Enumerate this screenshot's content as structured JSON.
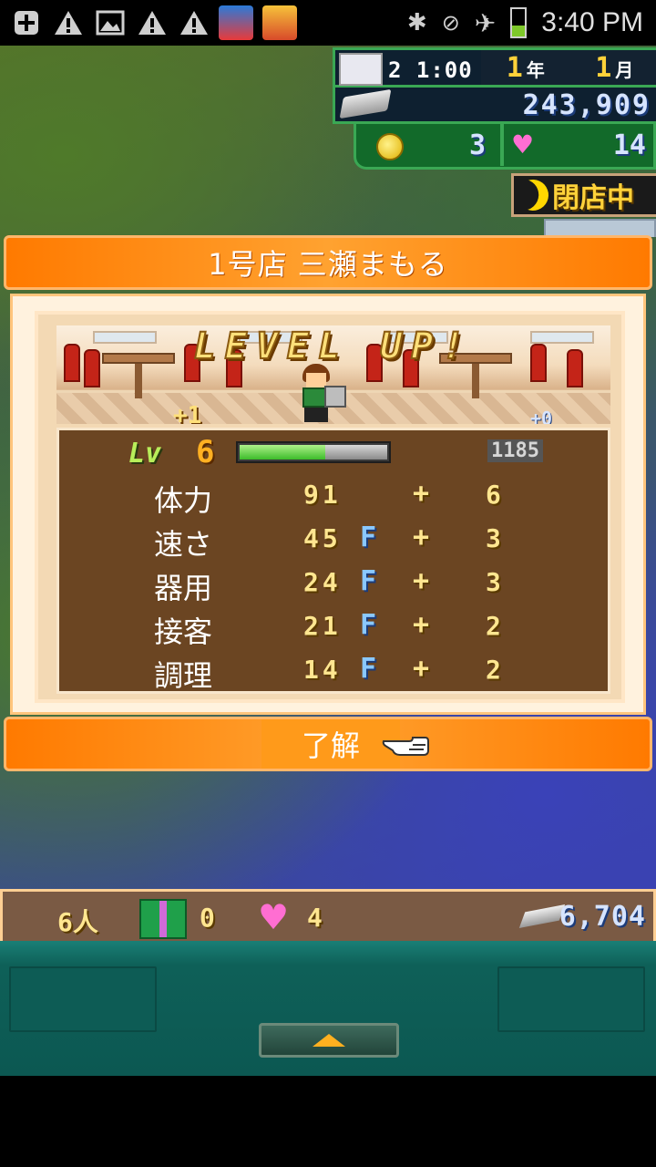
{
  "status_bar": {
    "time": "3:40 PM",
    "icons": [
      "plus-icon",
      "warning-icon",
      "gallery-icon",
      "warning-icon",
      "warning-icon",
      "bingo-app-icon",
      "shinchan-app-icon"
    ],
    "right_icons": [
      "bluetooth-icon",
      "no-signal-icon",
      "airplane-icon",
      "battery-icon"
    ]
  },
  "hud": {
    "clock": "2 1:00",
    "year_num": "1",
    "year_unit": "年",
    "month_num": "1",
    "month_unit": "月",
    "money": "243,909",
    "coins": "3",
    "hearts": "14",
    "open_label": "閉店中"
  },
  "dialog": {
    "title": "1号店 三瀬まもる",
    "banner": "LEVEL UP!",
    "plus_left": "+1",
    "plus_right": "+0",
    "level_label": "Lv",
    "level": "6",
    "xp_progress": 0.58,
    "xp_text": "1185",
    "stats": [
      {
        "name": "体力",
        "value": "91",
        "rank": "",
        "plus": "+",
        "add": "6"
      },
      {
        "name": "速さ",
        "value": "45",
        "rank": "F",
        "plus": "+",
        "add": "3"
      },
      {
        "name": "器用",
        "value": "24",
        "rank": "F",
        "plus": "+",
        "add": "3"
      },
      {
        "name": "接客",
        "value": "21",
        "rank": "F",
        "plus": "+",
        "add": "2"
      },
      {
        "name": "調理",
        "value": "14",
        "rank": "F",
        "plus": "+",
        "add": "2"
      }
    ],
    "ok_label": "了解"
  },
  "info_bar": {
    "staff": "6人",
    "gifts": "0",
    "hearts": "4",
    "money": "6,704"
  },
  "colors": {
    "accent_orange": "#ff8a10",
    "stat_panel": "#6b4522",
    "hud_green": "#3aa854"
  }
}
